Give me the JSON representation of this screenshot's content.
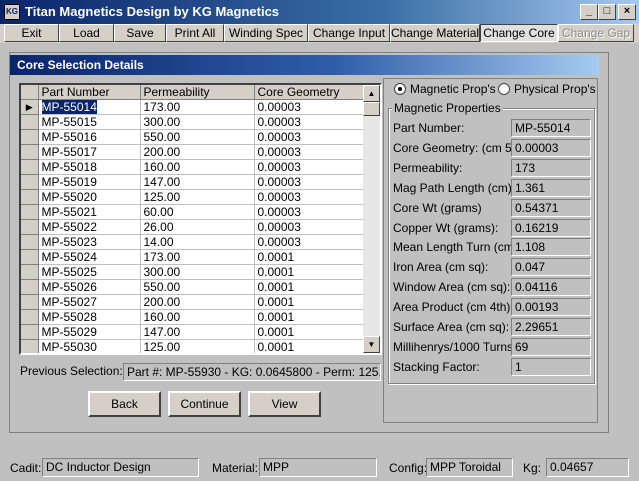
{
  "window": {
    "title": "Titan Magnetics Design by KG Magnetics",
    "icon_label": "KG",
    "controls": [
      "minimize-icon",
      "maximize-icon",
      "close-icon"
    ],
    "control_glyphs": {
      "minimize": "_",
      "maximize": "□",
      "close": "×"
    }
  },
  "menu": [
    {
      "label": "Exit",
      "state": "normal"
    },
    {
      "label": "Load",
      "state": "normal"
    },
    {
      "label": "Save",
      "state": "normal"
    },
    {
      "label": "Print All",
      "state": "normal"
    },
    {
      "label": "Winding Spec",
      "state": "normal"
    },
    {
      "label": "Change Input",
      "state": "normal"
    },
    {
      "label": "Change Material",
      "state": "normal"
    },
    {
      "label": "Change Core",
      "state": "pressed"
    },
    {
      "label": "Change Gap",
      "state": "disabled"
    }
  ],
  "panel": {
    "title": "Core Selection Details"
  },
  "grid": {
    "columns": [
      "Part Number",
      "Permeability",
      "Core Geometry"
    ],
    "rows": [
      [
        "MP-55014",
        "173.00",
        "0.00003"
      ],
      [
        "MP-55015",
        "300.00",
        "0.00003"
      ],
      [
        "MP-55016",
        "550.00",
        "0.00003"
      ],
      [
        "MP-55017",
        "200.00",
        "0.00003"
      ],
      [
        "MP-55018",
        "160.00",
        "0.00003"
      ],
      [
        "MP-55019",
        "147.00",
        "0.00003"
      ],
      [
        "MP-55020",
        "125.00",
        "0.00003"
      ],
      [
        "MP-55021",
        "60.00",
        "0.00003"
      ],
      [
        "MP-55022",
        "26.00",
        "0.00003"
      ],
      [
        "MP-55023",
        "14.00",
        "0.00003"
      ],
      [
        "MP-55024",
        "173.00",
        "0.0001"
      ],
      [
        "MP-55025",
        "300.00",
        "0.0001"
      ],
      [
        "MP-55026",
        "550.00",
        "0.0001"
      ],
      [
        "MP-55027",
        "200.00",
        "0.0001"
      ],
      [
        "MP-55028",
        "160.00",
        "0.0001"
      ],
      [
        "MP-55029",
        "147.00",
        "0.0001"
      ],
      [
        "MP-55030",
        "125.00",
        "0.0001"
      ]
    ],
    "selected_row": 0,
    "row_marker": "▶"
  },
  "previous_selection": {
    "label": "Previous Selection:",
    "value": "Part #: MP-55930 - KG: 0.0645800 - Perm: 125."
  },
  "buttons": {
    "back": "Back",
    "continue": "Continue",
    "view": "View"
  },
  "radios": {
    "magnetic": "Magnetic Prop's",
    "physical": "Physical Prop's",
    "selected": "magnetic"
  },
  "magnetic_properties": {
    "title": "Magnetic Properties",
    "items": [
      {
        "label": "Part Number:",
        "value": "MP-55014"
      },
      {
        "label": "Core Geometry: (cm 5th)",
        "value": "0.00003"
      },
      {
        "label": "Permeability:",
        "value": "173"
      },
      {
        "label": "Mag Path Length (cm):",
        "value": "1.361"
      },
      {
        "label": "Core Wt (grams)",
        "value": "0.54371"
      },
      {
        "label": "Copper Wt (grams):",
        "value": "0.16219"
      },
      {
        "label": "Mean Length Turn (cm):",
        "value": "1.108"
      },
      {
        "label": "Iron Area (cm sq):",
        "value": "0.047"
      },
      {
        "label": "Window Area (cm sq):",
        "value": "0.04116"
      },
      {
        "label": "Area Product (cm 4th):",
        "value": "0.00193"
      },
      {
        "label": "Surface Area (cm sq):",
        "value": "2.29651"
      },
      {
        "label": "Millihenrys/1000 Turns:",
        "value": "69"
      },
      {
        "label": "Stacking Factor:",
        "value": "1"
      }
    ]
  },
  "status": {
    "cadit_label": "Cadit:",
    "cadit_value": "DC Inductor Design",
    "material_label": "Material:",
    "material_value": "MPP",
    "config_label": "Config:",
    "config_value": "MPP Toroidal",
    "kg_label": "Kg:",
    "kg_value": "0.04657"
  }
}
